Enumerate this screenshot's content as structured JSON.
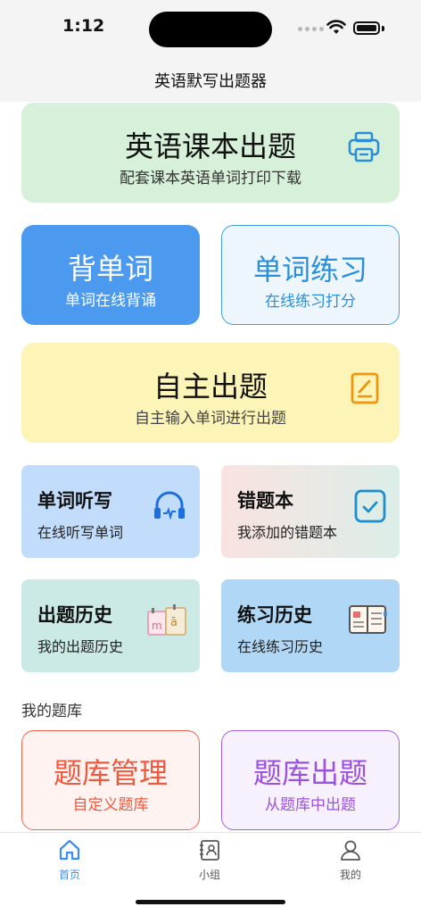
{
  "status_bar": {
    "time": "1:12"
  },
  "nav": {
    "title": "英语默写出题器"
  },
  "textbook_card": {
    "title": "英语课本出题",
    "subtitle": "配套课本英语单词打印下载",
    "icon": "printer-icon"
  },
  "memorize_card": {
    "title": "背单词",
    "subtitle": "单词在线背诵"
  },
  "practice_card": {
    "title": "单词练习",
    "subtitle": "在线练习打分"
  },
  "custom_card": {
    "title": "自主出题",
    "subtitle": "自主输入单词进行出题",
    "icon": "edit-note-icon"
  },
  "tiles": {
    "dictation": {
      "title": "单词听写",
      "subtitle": "在线听写单词",
      "icon": "headphones-icon"
    },
    "mistakes": {
      "title": "错题本",
      "subtitle": "我添加的错题本",
      "icon": "checkbox-icon"
    },
    "quiz_history": {
      "title": "出题历史",
      "subtitle": "我的出题历史",
      "icon": "calendar-cards-icon"
    },
    "practice_history": {
      "title": "练习历史",
      "subtitle": "在线练习历史",
      "icon": "notebook-icon"
    }
  },
  "section": {
    "my_bank": "我的题库"
  },
  "bank_manage_card": {
    "title": "题库管理",
    "subtitle": "自定义题库"
  },
  "bank_quiz_card": {
    "title": "题库出题",
    "subtitle": "从题库中出题"
  },
  "tab_bar": {
    "home": "首页",
    "group": "小组",
    "mine": "我的",
    "active": "home"
  },
  "colors": {
    "accent_blue": "#4b9af0",
    "practice_blue": "#2a8fd6",
    "manage_red": "#ee5a3f",
    "quiz_purple": "#9b51e0"
  }
}
